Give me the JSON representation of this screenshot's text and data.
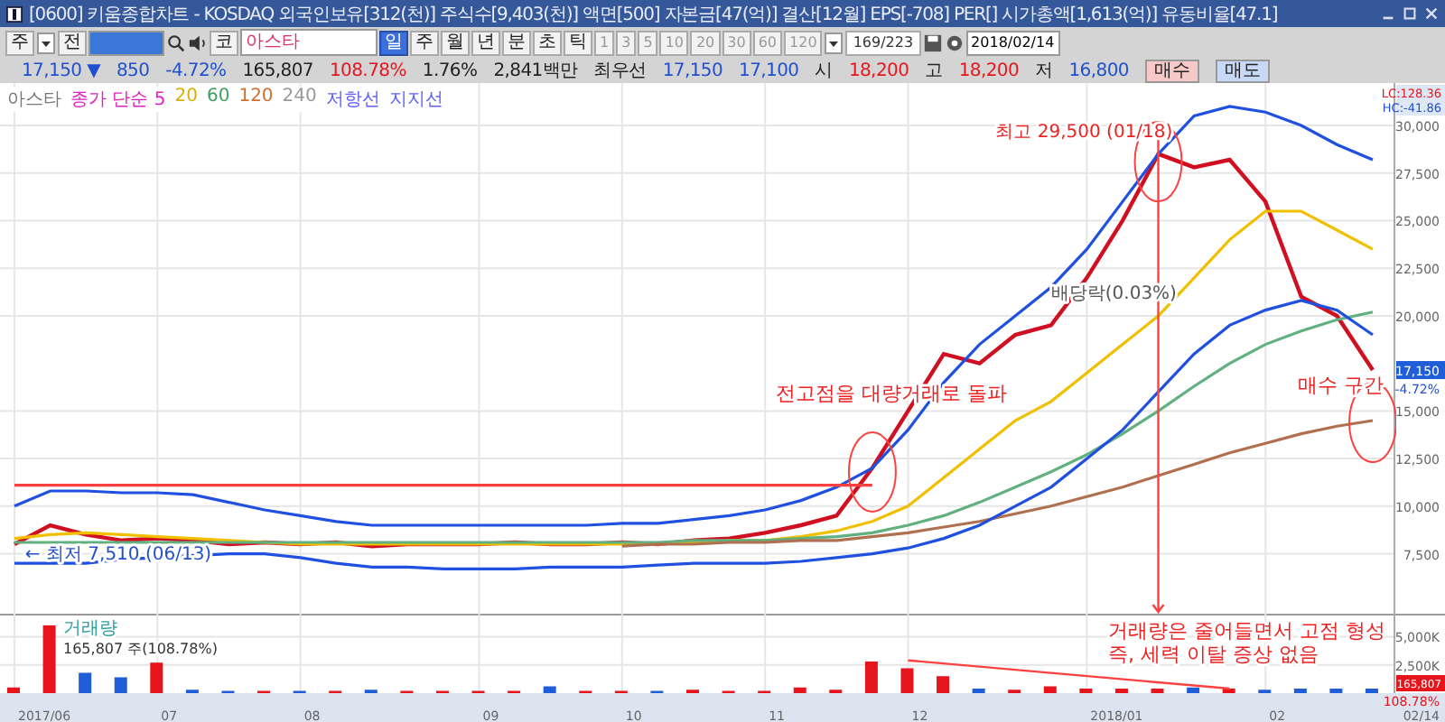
{
  "window": {
    "title": "[0600] 키움종합차트 - KOSDAQ 외국인보유[312(천)] 주식수[9,403(천)] 액면[500] 자본금[47(억)] 결산[12월] EPS[-708] PER[] 시가총액[1,613(억)] 유동비율[47.1]"
  },
  "toolbar": [
    {
      "kind": "button",
      "label": "주"
    },
    {
      "kind": "dropdown"
    },
    {
      "kind": "button",
      "label": "전"
    },
    {
      "kind": "code-field"
    },
    {
      "kind": "search"
    },
    {
      "kind": "speaker"
    },
    {
      "kind": "button",
      "label": "코"
    },
    {
      "kind": "name-field",
      "label": "아스타"
    },
    {
      "kind": "period",
      "label": "일",
      "selected": true
    },
    {
      "kind": "period",
      "label": "주",
      "selected": false
    },
    {
      "kind": "period",
      "label": "월",
      "selected": false
    },
    {
      "kind": "period",
      "label": "년",
      "selected": false
    },
    {
      "kind": "period",
      "label": "분",
      "selected": false
    },
    {
      "kind": "period",
      "label": "초",
      "selected": false
    },
    {
      "kind": "period",
      "label": "틱",
      "selected": false
    },
    {
      "kind": "number",
      "label": "1",
      "selected": false
    },
    {
      "kind": "number",
      "label": "3",
      "selected": false
    },
    {
      "kind": "number",
      "label": "5",
      "selected": false
    },
    {
      "kind": "number",
      "label": "10",
      "selected": false
    },
    {
      "kind": "number",
      "label": "20",
      "selected": false
    },
    {
      "kind": "number",
      "label": "30",
      "selected": false
    },
    {
      "kind": "number",
      "label": "60",
      "selected": false
    },
    {
      "kind": "number",
      "label": "120",
      "selected": false
    },
    {
      "kind": "dropdown"
    },
    {
      "kind": "counter",
      "label": "169/223"
    },
    {
      "kind": "save"
    },
    {
      "kind": "settings"
    },
    {
      "kind": "date",
      "label": "2018/02/14"
    }
  ],
  "quote": [
    {
      "text": "17,150 ▼",
      "color": "#2050d0"
    },
    {
      "text": "850",
      "color": "#2050d0"
    },
    {
      "text": "-4.72%",
      "color": "#2050d0"
    },
    {
      "text": "165,807",
      "color": "#222222"
    },
    {
      "text": "108.78%",
      "color": "#e8141c"
    },
    {
      "text": "1.76%",
      "color": "#222222"
    },
    {
      "text": "2,841백만",
      "color": "#222222"
    },
    {
      "text": "최우선",
      "color": "#222222"
    },
    {
      "text": "17,150",
      "color": "#2050d0"
    },
    {
      "text": "17,100",
      "color": "#2050d0"
    },
    {
      "text": "시",
      "color": "#222222"
    },
    {
      "text": "18,200",
      "color": "#e8141c"
    },
    {
      "text": "고",
      "color": "#222222"
    },
    {
      "text": "18,200",
      "color": "#e8141c"
    },
    {
      "text": "저",
      "color": "#222222"
    },
    {
      "text": "16,800",
      "color": "#2050d0"
    }
  ],
  "order_buttons": [
    {
      "label": "매수",
      "kind": "buy"
    },
    {
      "label": "매도",
      "kind": "sell"
    }
  ],
  "legend": [
    {
      "text": "아스타",
      "color": "#777777"
    },
    {
      "text": "종가 단순 5",
      "color": "#e020c0"
    },
    {
      "text": "20",
      "color": "#d8b000"
    },
    {
      "text": "60",
      "color": "#40a060"
    },
    {
      "text": "120",
      "color": "#d07030"
    },
    {
      "text": "240",
      "color": "#999999"
    },
    {
      "text": "저항선",
      "color": "#6060ff"
    },
    {
      "text": "지지선",
      "color": "#6060ff"
    }
  ],
  "price_chart": {
    "indicator": [
      "LC:128.36",
      "HC:-41.86"
    ],
    "last_price": "17,150",
    "last_change": "-4.72%",
    "chart_data": {
      "type": "line",
      "ylim": [
        4350,
        32230
      ],
      "grid": true,
      "yticks": [
        {
          "value": 7500,
          "label": "7,500"
        },
        {
          "value": 10000,
          "label": "10,000"
        },
        {
          "value": 12500,
          "label": "12,500"
        },
        {
          "value": 15000,
          "label": "15,000"
        },
        {
          "value": 20000,
          "label": "20,000"
        },
        {
          "value": 22500,
          "label": "22,500"
        },
        {
          "value": 25000,
          "label": "25,000"
        },
        {
          "value": 27500,
          "label": "27,500"
        },
        {
          "value": 30000,
          "label": "30,000"
        }
      ],
      "series": [
        {
          "color": "#d01020",
          "values": [
            8000,
            9000,
            8500,
            8200,
            8300,
            8200,
            8000,
            8100,
            8000,
            8100,
            7900,
            8000,
            8000,
            8000,
            8100,
            8000,
            8000,
            8100,
            8000,
            8200,
            8300,
            8600,
            9000,
            9500,
            12000,
            15000,
            18000,
            17500,
            19000,
            19500,
            22000,
            25000,
            28500,
            27800,
            28200,
            26000,
            21000,
            20000,
            17150
          ]
        },
        {
          "color": "#2050e0",
          "values": [
            10000,
            10800,
            10800,
            10700,
            10700,
            10600,
            10200,
            9800,
            9500,
            9200,
            9000,
            9000,
            9000,
            9000,
            9000,
            9000,
            9000,
            9100,
            9100,
            9300,
            9500,
            9800,
            10300,
            11000,
            12000,
            14000,
            16500,
            18500,
            20000,
            21500,
            23500,
            26000,
            28500,
            30500,
            31000,
            30700,
            30000,
            29000,
            28200
          ]
        },
        {
          "color": "#f0c000",
          "values": [
            8300,
            8500,
            8600,
            8500,
            8400,
            8300,
            8200,
            8100,
            8000,
            8000,
            8000,
            8000,
            8000,
            8000,
            8000,
            8000,
            8000,
            8000,
            8000,
            8100,
            8200,
            8200,
            8400,
            8700,
            9200,
            10000,
            11500,
            13000,
            14500,
            15500,
            17000,
            18500,
            20000,
            22000,
            24000,
            25500,
            25500,
            24500,
            23500
          ]
        },
        {
          "color": "#60b080",
          "values": [
            8100,
            8100,
            8100,
            8100,
            8100,
            8100,
            8100,
            8100,
            8100,
            8100,
            8100,
            8100,
            8100,
            8100,
            8100,
            8100,
            8100,
            8100,
            8100,
            8200,
            8200,
            8200,
            8300,
            8400,
            8600,
            9000,
            9500,
            10200,
            11000,
            11800,
            12700,
            13800,
            15000,
            16300,
            17500,
            18500,
            19200,
            19800,
            20200
          ]
        },
        {
          "color": "#b07050",
          "values": [
            null,
            null,
            null,
            null,
            null,
            null,
            null,
            null,
            null,
            null,
            null,
            null,
            null,
            null,
            null,
            null,
            null,
            7900,
            8000,
            8000,
            8100,
            8100,
            8200,
            8200,
            8400,
            8600,
            8900,
            9200,
            9600,
            10000,
            10500,
            11000,
            11600,
            12200,
            12800,
            13300,
            13800,
            14200,
            14500
          ]
        },
        {
          "color": "#ff4040",
          "values": [
            11100,
            11100,
            11100,
            11100,
            11100,
            11100,
            11100,
            11100,
            11100,
            11100,
            11100,
            11100,
            11100,
            11100,
            11100,
            11100,
            11100,
            11100,
            11100,
            11100,
            11100,
            11100,
            11100,
            11100,
            11100,
            null,
            null,
            null,
            null,
            null,
            null,
            null,
            null,
            null,
            null,
            null,
            null,
            null,
            null
          ]
        },
        {
          "color": "#2050e0",
          "values": [
            7000,
            7000,
            7000,
            7200,
            7300,
            7400,
            7500,
            7500,
            7300,
            7000,
            6800,
            6800,
            6700,
            6700,
            6700,
            6800,
            6800,
            6800,
            6900,
            7000,
            7000,
            7000,
            7100,
            7300,
            7500,
            7800,
            8300,
            9000,
            10000,
            11000,
            12500,
            14000,
            16000,
            18000,
            19500,
            20300,
            20800,
            20300,
            19000
          ]
        }
      ],
      "annotations": [
        "전고점을 대량거래로 돌파",
        "최고 29,500 (01/18)",
        "배당락(0.03%)",
        "매수 구간",
        "← 최저 7,510 (06/13)"
      ]
    }
  },
  "volume_chart": {
    "title": "거래량",
    "summary": "165,807 주(108.78%)",
    "last_volume": "165,807",
    "last_ratio": "108.78%",
    "chart_data": {
      "type": "bar",
      "ylim": [
        0,
        7030
      ],
      "grid": true,
      "yticks": [
        {
          "value": 2500,
          "label": "2,500K"
        },
        {
          "value": 5000,
          "label": "5,000K"
        }
      ],
      "values": [
        500,
        6000,
        1800,
        1400,
        2700,
        300,
        200,
        200,
        200,
        200,
        300,
        200,
        200,
        200,
        200,
        600,
        200,
        200,
        200,
        300,
        200,
        200,
        500,
        300,
        2800,
        2200,
        1500,
        400,
        300,
        600,
        400,
        400,
        400,
        500,
        400,
        300,
        400,
        400,
        400
      ],
      "annotations": [
        "거래량은 줄어들면서 고점 형성",
        "즉, 세력 이탈 증상 없음"
      ]
    }
  },
  "date_axis": [
    "2017/06",
    "07",
    "08",
    "09",
    "10",
    "11",
    "12",
    "2018/01",
    "02",
    "02/14"
  ]
}
